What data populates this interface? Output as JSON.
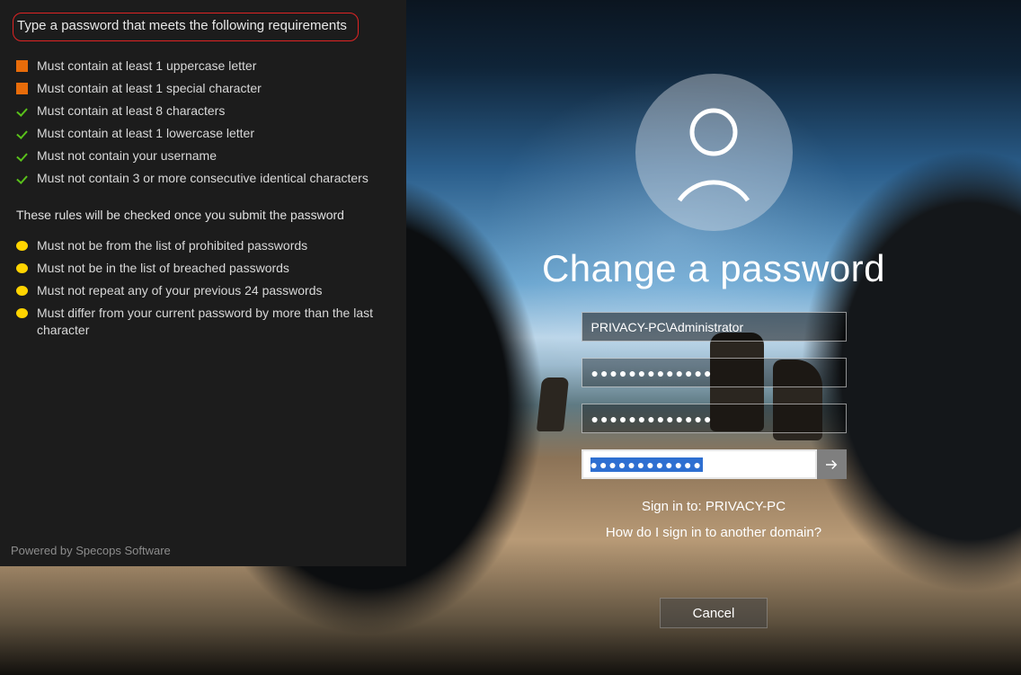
{
  "panel": {
    "heading": "Type a password that meets the following requirements",
    "live_rules": [
      {
        "status": "fail",
        "text": "Must contain at least 1 uppercase letter"
      },
      {
        "status": "fail",
        "text": "Must contain at least 1 special character"
      },
      {
        "status": "pass",
        "text": "Must contain at least 8 characters"
      },
      {
        "status": "pass",
        "text": "Must contain at least 1 lowercase letter"
      },
      {
        "status": "pass",
        "text": "Must not contain your username"
      },
      {
        "status": "pass",
        "text": "Must not contain 3 or more consecutive identical characters"
      }
    ],
    "deferred_note": "These rules will be checked once you submit the password",
    "deferred_rules": [
      {
        "status": "pend",
        "text": "Must not be from the list of prohibited passwords"
      },
      {
        "status": "pend",
        "text": "Must not be in the list of breached passwords"
      },
      {
        "status": "pend",
        "text": "Must not repeat any of your previous 24 passwords"
      },
      {
        "status": "pend",
        "text": "Must differ from your current password by more than the last character"
      }
    ],
    "powered_by": "Powered by Specops Software"
  },
  "login": {
    "title": "Change a password",
    "username": "PRIVACY-PC\\Administrator",
    "old_password_mask": "●●●●●●●●●●●●●",
    "new_password_mask": "●●●●●●●●●●●●●",
    "confirm_mask": "●●●●●●●●●●●●",
    "sign_in_to": "Sign in to: PRIVACY-PC",
    "other_domain": "How do I sign in to another domain?",
    "cancel": "Cancel"
  },
  "colors": {
    "fail": "#e86c0a",
    "pass": "#59c11a",
    "pend": "#ffd400",
    "heading_border": "#e02424"
  }
}
